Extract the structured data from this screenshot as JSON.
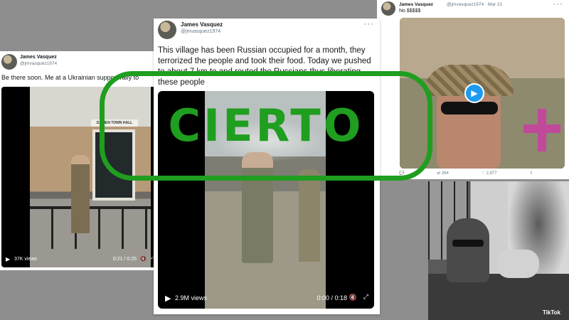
{
  "tweets": [
    {
      "name": "James Vasquez",
      "handle": "@jmvasquez1974",
      "text": "Be there soon. Me at a Ukrainian support rally to",
      "video_sign": "DARIEN TOWN HALL",
      "views": "37K views",
      "time": "0:21 / 0:25"
    },
    {
      "name": "James Vasquez",
      "handle": "@jmvasquez1974",
      "text": "This village has been Russian occupied for a month, they terrorized the people and took their food. Today we pushed to about 7 km to and routed the Russians thus liberating these people",
      "views": "2.9M views",
      "time": "0:00 / 0:18"
    },
    {
      "name": "James Vasquez",
      "handle": "@jmvasquez1974 · Mar 21",
      "text": "No $$$$$",
      "replies": "",
      "retweets": "264",
      "likes": "2,977"
    }
  ],
  "tiktok_label": "TikTok",
  "stamp": {
    "label": "CIERTO",
    "color": "#1f9e1f"
  },
  "icons": {
    "more": "more-icon",
    "play": "play-icon",
    "volume": "volume-icon",
    "fullscreen": "fullscreen-icon"
  }
}
